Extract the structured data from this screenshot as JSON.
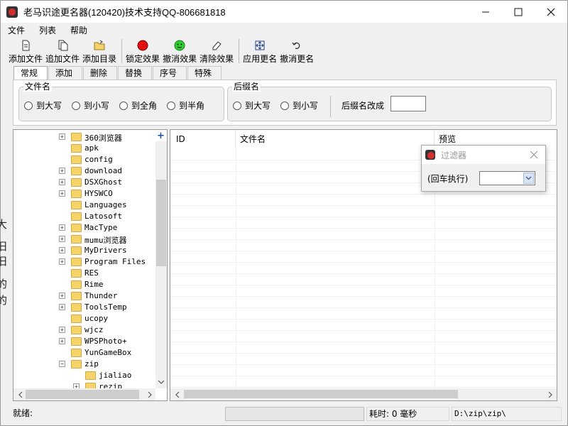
{
  "window": {
    "title": "老马识途更名器(120420)技术支持QQ-806681818",
    "minimize": "—",
    "maximize": "☐",
    "close": "✕"
  },
  "menu": [
    "文件",
    "列表",
    "帮助"
  ],
  "toolbar": [
    {
      "label": "添加文件",
      "icon": "add-file-icon"
    },
    {
      "label": "追加文件",
      "icon": "append-file-icon"
    },
    {
      "label": "添加目录",
      "icon": "add-folder-icon"
    },
    {
      "label": "锁定效果",
      "icon": "red-circle-icon"
    },
    {
      "label": "撤消效果",
      "icon": "green-face-icon"
    },
    {
      "label": "清除效果",
      "icon": "eraser-icon"
    },
    {
      "label": "应用更名",
      "icon": "apply-rename-icon"
    },
    {
      "label": "撤消更名",
      "icon": "undo-icon"
    }
  ],
  "tabs": [
    "常规",
    "添加",
    "删除",
    "替换",
    "序号",
    "特殊"
  ],
  "filename_group": {
    "title": "文件名",
    "options": [
      "到大写",
      "到小写",
      "到全角",
      "到半角"
    ]
  },
  "suffix_group": {
    "title": "后缀名",
    "options": [
      "到大写",
      "到小写"
    ],
    "change_label": "后缀名改成",
    "change_value": ""
  },
  "tree": {
    "add_symbol": "+",
    "items": [
      {
        "label": "360浏览器",
        "expander": "plus"
      },
      {
        "label": "apk",
        "expander": "none"
      },
      {
        "label": "config",
        "expander": "none"
      },
      {
        "label": "download",
        "expander": "plus"
      },
      {
        "label": "DSXGhost",
        "expander": "plus"
      },
      {
        "label": "HYSWCO",
        "expander": "plus"
      },
      {
        "label": "Languages",
        "expander": "none"
      },
      {
        "label": "Latosoft",
        "expander": "none"
      },
      {
        "label": "MacType",
        "expander": "plus"
      },
      {
        "label": "mumu浏览器",
        "expander": "plus"
      },
      {
        "label": "MyDrivers",
        "expander": "plus"
      },
      {
        "label": "Program Files",
        "expander": "plus"
      },
      {
        "label": "RES",
        "expander": "none"
      },
      {
        "label": "Rime",
        "expander": "none"
      },
      {
        "label": "Thunder",
        "expander": "plus"
      },
      {
        "label": "ToolsTemp",
        "expander": "plus"
      },
      {
        "label": "ucopy",
        "expander": "none"
      },
      {
        "label": "wjcz",
        "expander": "plus"
      },
      {
        "label": "WPSPhoto+",
        "expander": "plus"
      },
      {
        "label": "YunGameBox",
        "expander": "none"
      },
      {
        "label": "zip",
        "expander": "minus"
      },
      {
        "label": "jialiao",
        "expander": "none",
        "child": true
      },
      {
        "label": "rezip",
        "expander": "plus",
        "child": true
      }
    ]
  },
  "list": {
    "columns": [
      "ID",
      "文件名",
      "预览"
    ]
  },
  "filter_popup": {
    "title": "过滤器",
    "label": "(回车执行)",
    "value": ""
  },
  "status": {
    "ready": "就绪:",
    "elapsed": "耗时: 0 毫秒",
    "path": "D:\\zip\\zip\\"
  },
  "background_fragments": [
    "大",
    "旧",
    "旧",
    "的",
    "的"
  ]
}
